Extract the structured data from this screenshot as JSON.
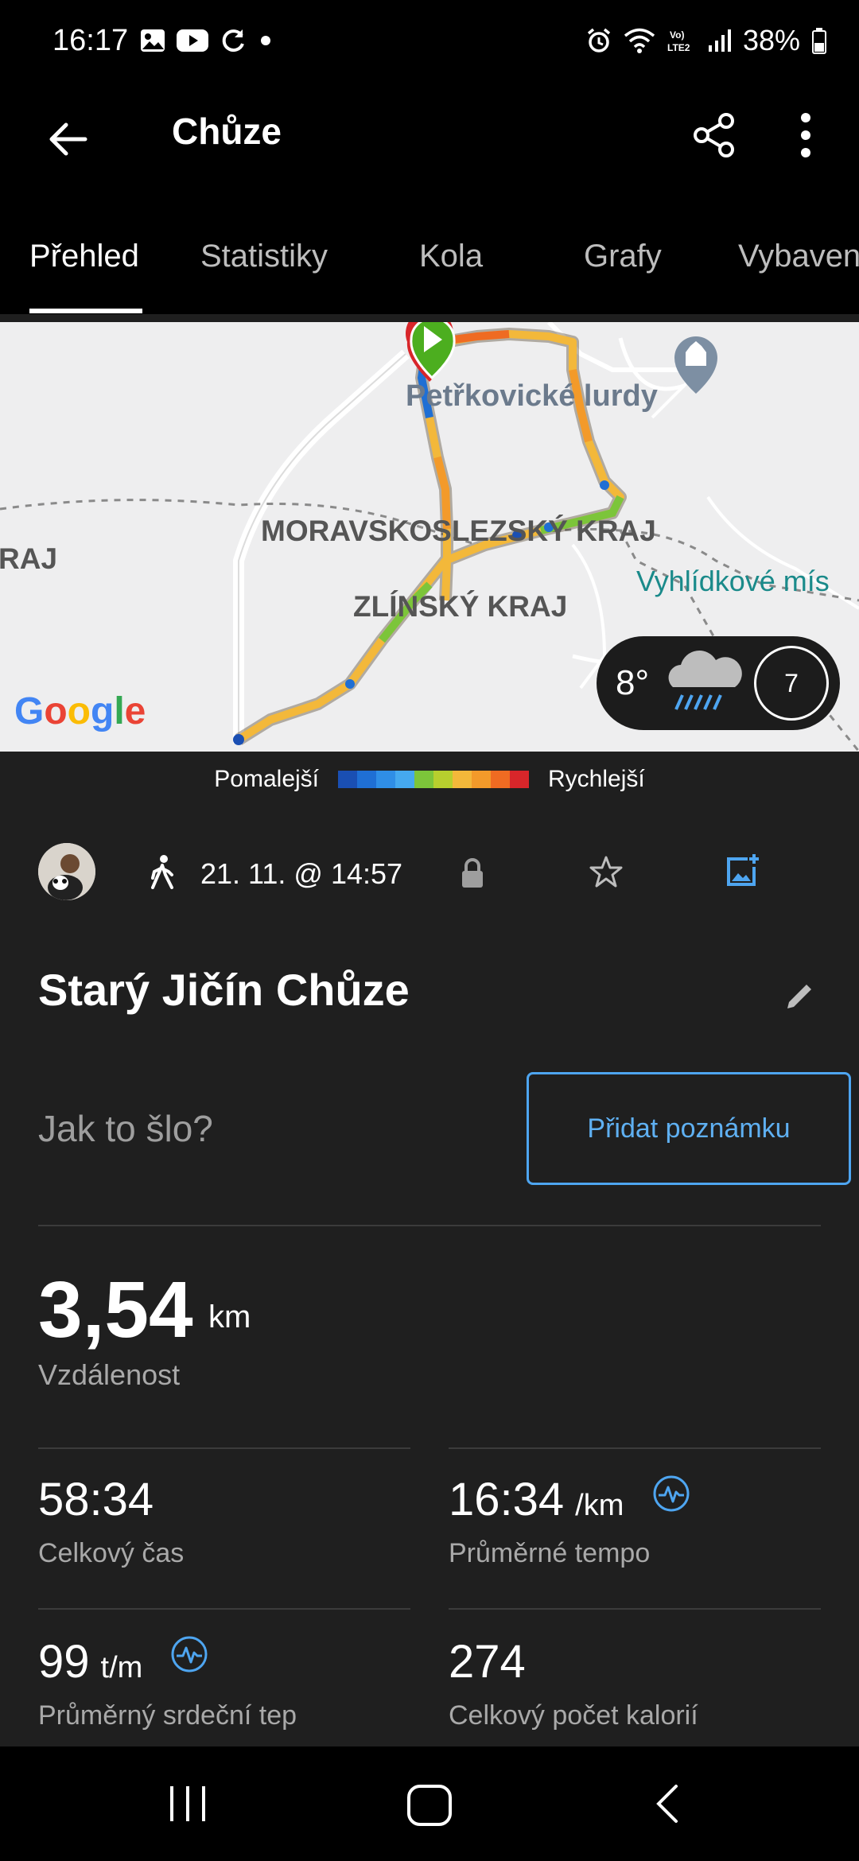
{
  "status_bar": {
    "time": "16:17",
    "battery": "38%",
    "left_icons": [
      "gallery-icon",
      "youtube-icon",
      "sync-icon",
      "dot-icon"
    ],
    "right_icons": [
      "alarm-icon",
      "wifi-icon",
      "volte-icon",
      "signal-icon",
      "battery-icon"
    ]
  },
  "app_bar": {
    "title": "Chůze",
    "actions": [
      "back-arrow-icon",
      "share-icon",
      "more-vert-icon"
    ]
  },
  "tabs": [
    {
      "label": "Přehled",
      "active": true
    },
    {
      "label": "Statistiky",
      "active": false
    },
    {
      "label": "Kola",
      "active": false
    },
    {
      "label": "Grafy",
      "active": false
    },
    {
      "label": "Vybaven",
      "active": false
    }
  ],
  "map": {
    "labels": {
      "poi": "Petřkovické lurdy",
      "region1": "MORAVSKOSLEZSKÝ KRAJ",
      "region2": "ZLÍNSKÝ KRAJ",
      "region_left": "RAJ",
      "viewpoint": "Vyhlídkové mís"
    },
    "provider": "Google",
    "weather": {
      "temp": "8°",
      "icon": "rain-cloud-icon",
      "badge": "7"
    }
  },
  "legend": {
    "slow": "Pomalejší",
    "fast": "Rychlejší",
    "colors": [
      "#1a4fb3",
      "#1f6fd4",
      "#2f8ee6",
      "#45a9ef",
      "#7cc53a",
      "#b7cf2e",
      "#f3b83a",
      "#f39a2a",
      "#ef6b22",
      "#d8262a"
    ]
  },
  "activity": {
    "date": "21. 11. @ 14:57",
    "title": "Starý Jičín Chůze",
    "prompt": "Jak to šlo?",
    "note_button": "Přidat poznámku",
    "accent": "#4ea5f0"
  },
  "stats": {
    "distance": {
      "value": "3,54",
      "unit": "km",
      "label": "Vzdálenost"
    },
    "total_time": {
      "value": "58:34",
      "label": "Celkový čas"
    },
    "avg_pace": {
      "value": "16:34",
      "unit": "/km",
      "label": "Průměrné tempo"
    },
    "avg_hr": {
      "value": "99",
      "unit": "t/m",
      "label": "Průměrný srdeční tep"
    },
    "calories": {
      "value": "274",
      "label": "Celkový počet kalorií"
    }
  },
  "nav_bar": [
    "recents-icon",
    "home-icon",
    "back-icon"
  ]
}
